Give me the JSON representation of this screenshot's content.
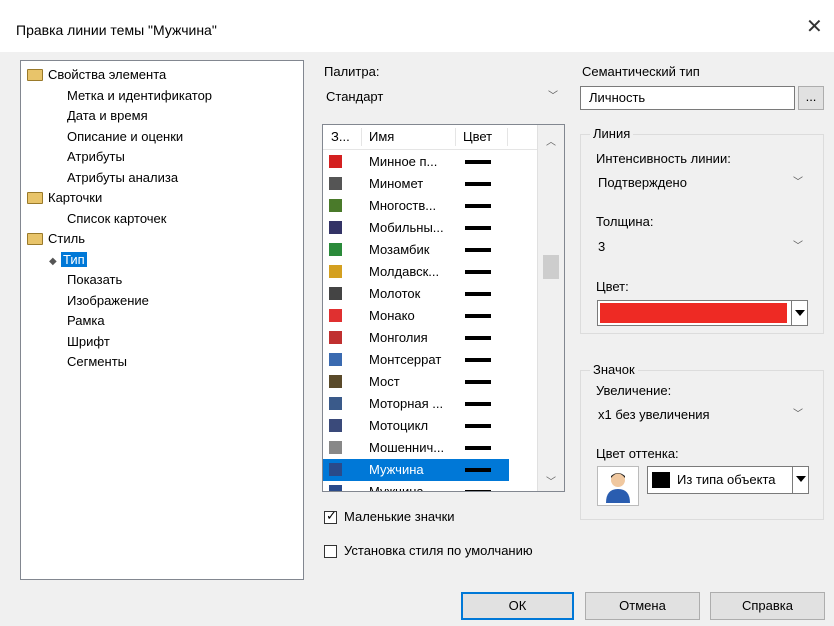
{
  "window": {
    "title": "Правка линии темы \"Мужчина\""
  },
  "tree": {
    "items": [
      {
        "label": "Свойства элемента",
        "level": 0,
        "folder": true
      },
      {
        "label": "Метка и идентификатор",
        "level": 1
      },
      {
        "label": "Дата и время",
        "level": 1
      },
      {
        "label": "Описание и оценки",
        "level": 1
      },
      {
        "label": "Атрибуты",
        "level": 1
      },
      {
        "label": "Атрибуты анализа",
        "level": 1
      },
      {
        "label": "Карточки",
        "level": 0,
        "folder": true
      },
      {
        "label": "Список карточек",
        "level": 1
      },
      {
        "label": "Стиль",
        "level": 0,
        "folder": true
      },
      {
        "label": "Тип",
        "level": 1,
        "selected": true
      },
      {
        "label": "Показать",
        "level": 1
      },
      {
        "label": "Изображение",
        "level": 1
      },
      {
        "label": "Рамка",
        "level": 1
      },
      {
        "label": "Шрифт",
        "level": 1
      },
      {
        "label": "Сегменты",
        "level": 1
      }
    ]
  },
  "palette": {
    "label": "Палитра:",
    "value": "Стандарт"
  },
  "list": {
    "columns": [
      "З...",
      "Имя",
      "Цвет"
    ],
    "rows": [
      {
        "name": "Минное п...",
        "icon": "mine-icon",
        "iconColor": "#d42020"
      },
      {
        "name": "Миномет",
        "icon": "mortar-icon",
        "iconColor": "#555555"
      },
      {
        "name": "Многоств...",
        "icon": "multibarrel-icon",
        "iconColor": "#4a7a2a"
      },
      {
        "name": "Мобильны...",
        "icon": "mobile-phone-icon",
        "iconColor": "#333366"
      },
      {
        "name": "Мозамбик",
        "icon": "flag-mozambique-icon",
        "iconColor": "#2a8a3a"
      },
      {
        "name": "Молдавск...",
        "icon": "flag-moldova-icon",
        "iconColor": "#d4a020"
      },
      {
        "name": "Молоток",
        "icon": "hammer-icon",
        "iconColor": "#444444"
      },
      {
        "name": "Монако",
        "icon": "flag-monaco-icon",
        "iconColor": "#e03030"
      },
      {
        "name": "Монголия",
        "icon": "flag-mongolia-icon",
        "iconColor": "#c03030"
      },
      {
        "name": "Монтсеррат",
        "icon": "flag-montserrat-icon",
        "iconColor": "#3a6ab0"
      },
      {
        "name": "Мост",
        "icon": "bridge-icon",
        "iconColor": "#5a4a2a"
      },
      {
        "name": "Моторная ...",
        "icon": "motorboat-icon",
        "iconColor": "#3a5a8a"
      },
      {
        "name": "Мотоцикл",
        "icon": "motorcycle-icon",
        "iconColor": "#3a4a7a"
      },
      {
        "name": "Мошеннич...",
        "icon": "fraud-icon",
        "iconColor": "#888888"
      },
      {
        "name": "Мужчина",
        "icon": "man-icon",
        "iconColor": "#2a4a8a",
        "selected": true
      },
      {
        "name": "Мужчина-...",
        "icon": "man-icon",
        "iconColor": "#2a4a8a"
      }
    ]
  },
  "small_icons": {
    "label": "Маленькие значки",
    "checked": true
  },
  "default_style": {
    "label": "Установка стиля по умолчанию",
    "checked": false
  },
  "semantic": {
    "label": "Семантический тип",
    "value": "Личность",
    "browse": "..."
  },
  "line_group": {
    "title": "Линия",
    "intensity_label": "Интенсивность линии:",
    "intensity_value": "Подтверждено",
    "thickness_label": "Толщина:",
    "thickness_value": "3",
    "color_label": "Цвет:",
    "color_value": "#ee2a24"
  },
  "icon_group": {
    "title": "Значок",
    "zoom_label": "Увеличение:",
    "zoom_value": "x1 без увеличения",
    "tint_label": "Цвет оттенка:",
    "tint_value": "Из типа объекта",
    "tint_swatch": "#000000"
  },
  "buttons": {
    "ok": "ОК",
    "cancel": "Отмена",
    "help": "Справка"
  }
}
